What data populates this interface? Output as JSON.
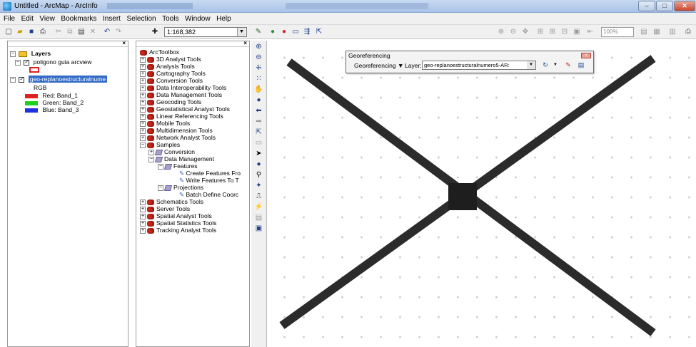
{
  "window": {
    "title": "Untitled - ArcMap - ArcInfo",
    "minimize": "–",
    "maximize": "□",
    "close": "✕"
  },
  "menu": [
    "File",
    "Edit",
    "View",
    "Bookmarks",
    "Insert",
    "Selection",
    "Tools",
    "Window",
    "Help"
  ],
  "toolbar": {
    "scale": "1:168,382",
    "zoom_percent": "100%"
  },
  "toc": {
    "root": "Layers",
    "layers": [
      {
        "name": "poligono guia arcview",
        "checked": true
      },
      {
        "name": "geo-replanoestructuralnume",
        "checked": true,
        "selected": true
      }
    ],
    "rgb_label": "RGB",
    "bands": [
      {
        "label": "Red:",
        "band": "Band_1",
        "color": "#e02020"
      },
      {
        "label": "Green:",
        "band": "Band_2",
        "color": "#20d020"
      },
      {
        "label": "Blue:",
        "band": "Band_3",
        "color": "#2030e0"
      }
    ]
  },
  "toolbox": {
    "root": "ArcToolbox",
    "items": [
      "3D Analyst Tools",
      "Analysis Tools",
      "Cartography Tools",
      "Conversion Tools",
      "Data Interoperability Tools",
      "Data Management Tools",
      "Geocoding Tools",
      "Geostatistical Analyst Tools",
      "Linear Referencing Tools",
      "Mobile Tools",
      "Multidimension Tools",
      "Network Analyst Tools",
      "Samples",
      "Conversion",
      "Data Management",
      "Features",
      "Create Features Fro",
      "Write Features To T",
      "Projections",
      "Batch Define Coorc",
      "Schematics Tools",
      "Server Tools",
      "Spatial Analyst Tools",
      "Spatial Statistics Tools",
      "Tracking Analyst Tools"
    ]
  },
  "georef": {
    "title": "Georeferencing",
    "menu_label": "Georeferencing ▼",
    "layer_label": "Layer:",
    "layer_value": "geo-replanoestructuralnumero5-AR:"
  }
}
